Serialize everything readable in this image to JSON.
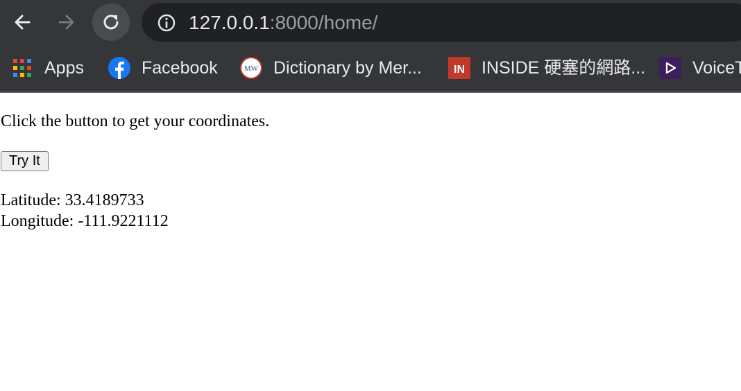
{
  "browser": {
    "url_host": "127.0.0.1",
    "url_path": ":8000/home/",
    "bookmarks": [
      {
        "label": "Apps",
        "icon": "apps-grid-icon"
      },
      {
        "label": "Facebook",
        "icon": "facebook-icon"
      },
      {
        "label": "Dictionary by Mer...",
        "icon": "merriam-webster-icon",
        "icon_text": "MW"
      },
      {
        "label": "INSIDE 硬塞的網路...",
        "icon": "inside-icon",
        "icon_text": "IN"
      },
      {
        "label": "VoiceT",
        "icon": "voice-play-icon"
      }
    ]
  },
  "page": {
    "instruction": "Click the button to get your coordinates.",
    "button_label": "Try It",
    "latitude_text": "Latitude: 33.4189733",
    "longitude_text": "Longitude: -111.9221112"
  },
  "colors": {
    "chrome_bg": "#35363a",
    "omnibox_bg": "#202124",
    "facebook_blue": "#1877f2",
    "inside_red": "#c0392b",
    "voice_purple": "#3a1f5c"
  }
}
